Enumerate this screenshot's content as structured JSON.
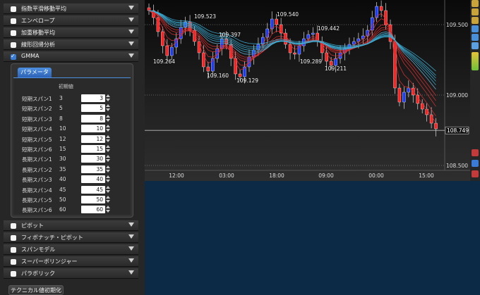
{
  "sidebar": {
    "top_items": [
      {
        "label": "指数平滑移動平均",
        "checked": false
      },
      {
        "label": "エンベロープ",
        "checked": false
      },
      {
        "label": "加重移動平均",
        "checked": false
      },
      {
        "label": "線形回帰分析",
        "checked": false
      },
      {
        "label": "GMMA",
        "checked": true
      }
    ],
    "panel": {
      "tab_label": "パラメータ",
      "initial_header": "初期値",
      "params": [
        {
          "label": "短期スパン1",
          "default": "3",
          "value": "3"
        },
        {
          "label": "短期スパン2",
          "default": "5",
          "value": "5"
        },
        {
          "label": "短期スパン3",
          "default": "8",
          "value": "8"
        },
        {
          "label": "短期スパン4",
          "default": "10",
          "value": "10"
        },
        {
          "label": "短期スパン5",
          "default": "12",
          "value": "12"
        },
        {
          "label": "短期スパン6",
          "default": "15",
          "value": "15"
        },
        {
          "label": "長期スパン1",
          "default": "30",
          "value": "30"
        },
        {
          "label": "長期スパン2",
          "default": "35",
          "value": "35"
        },
        {
          "label": "長期スパン3",
          "default": "40",
          "value": "40"
        },
        {
          "label": "長期スパン4",
          "default": "45",
          "value": "45"
        },
        {
          "label": "長期スパン5",
          "default": "50",
          "value": "50"
        },
        {
          "label": "長期スパン6",
          "default": "60",
          "value": "60"
        }
      ]
    },
    "bottom_items": [
      {
        "label": "ピボット",
        "checked": false
      },
      {
        "label": "フィボナッチ・ピボット",
        "checked": false
      },
      {
        "label": "スパンモデル",
        "checked": false
      },
      {
        "label": "スーパーボリンジャー",
        "checked": false
      },
      {
        "label": "パラボリック",
        "checked": false
      }
    ],
    "reset_button": "テクニカル値初期化"
  },
  "chart": {
    "price_labels": [
      "109.500",
      "109.000",
      "108.500"
    ],
    "current_price": "108.749",
    "time_labels": [
      "12:00",
      "03:00",
      "18:00",
      "09:00",
      "00:00",
      "15:00"
    ],
    "annotations": [
      "109.523",
      "109.540",
      "109.397",
      "109.442",
      "109.264",
      "109.160",
      "109.129",
      "109.289",
      "109.211"
    ],
    "colors": {
      "up": "#1a3cff",
      "down": "#ff2020",
      "short_ma": "#e03030",
      "long_ma": "#3bb0d8"
    }
  },
  "chart_data": {
    "type": "candlestick",
    "x": [
      "12:00",
      "03:00",
      "18:00",
      "09:00",
      "00:00",
      "15:00"
    ],
    "ylim": [
      108.5,
      109.65
    ],
    "y_ticks": [
      109.5,
      109.0,
      108.5
    ],
    "current": 108.749,
    "highs": [
      109.523,
      109.54,
      109.442
    ],
    "lows": [
      109.264,
      109.16,
      109.129,
      109.289,
      109.211
    ],
    "mid_label": 109.397,
    "price_path": [
      109.6,
      109.55,
      109.45,
      109.35,
      109.28,
      109.34,
      109.4,
      109.48,
      109.52,
      109.46,
      109.38,
      109.3,
      109.2,
      109.17,
      109.26,
      109.33,
      109.4,
      109.36,
      109.26,
      109.15,
      109.13,
      109.2,
      109.27,
      109.32,
      109.36,
      109.41,
      109.47,
      109.54,
      109.5,
      109.44,
      109.36,
      109.3,
      109.29,
      109.35,
      109.4,
      109.43,
      109.44,
      109.38,
      109.3,
      109.24,
      109.21,
      109.26,
      109.3,
      109.33,
      109.36,
      109.38,
      109.4,
      109.42,
      109.46,
      109.55,
      109.63,
      109.6,
      109.5,
      109.38,
      109.05,
      108.95,
      109.02,
      109.05,
      109.0,
      108.94,
      108.9,
      108.86,
      108.8,
      108.76
    ]
  }
}
